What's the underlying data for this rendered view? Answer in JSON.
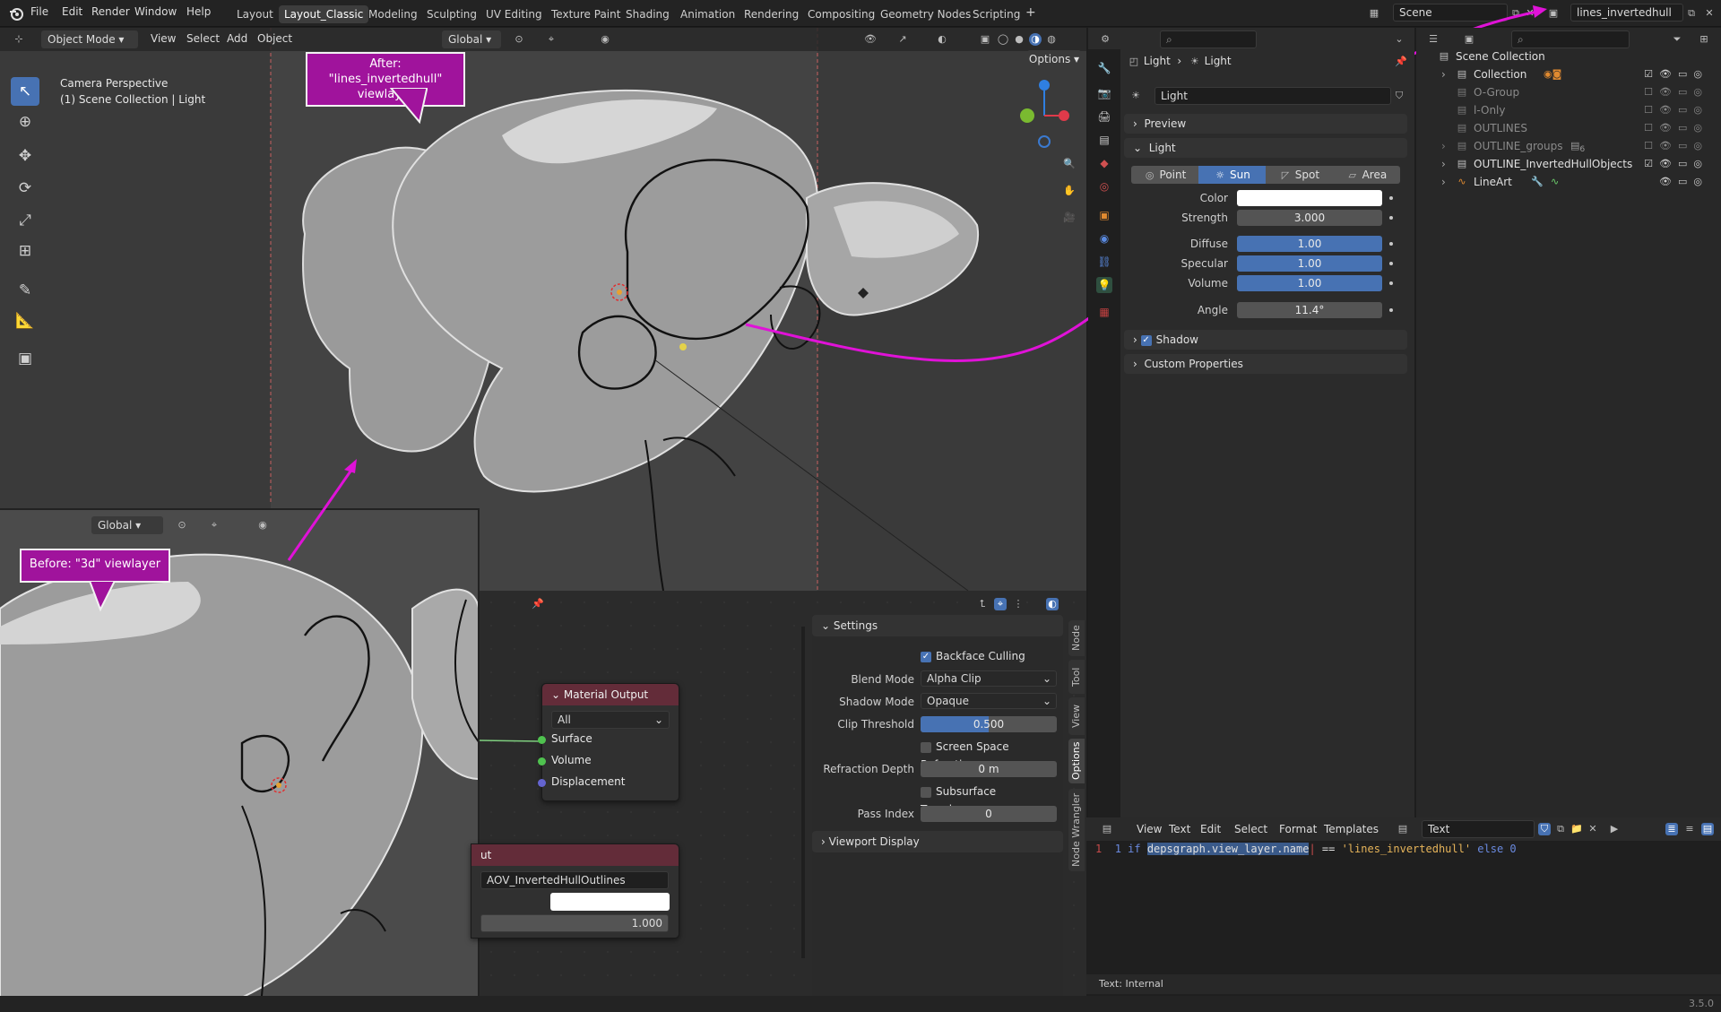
{
  "topbar": {
    "menus": [
      "File",
      "Edit",
      "Render",
      "Window",
      "Help"
    ],
    "workspaces": [
      "Layout",
      "Layout_Classic",
      "Modeling",
      "Sculpting",
      "UV Editing",
      "Texture Paint",
      "Shading",
      "Animation",
      "Rendering",
      "Compositing",
      "Geometry Nodes",
      "Scripting"
    ],
    "active_workspace": "Layout_Classic",
    "scene_name": "Scene",
    "view_layer_name": "lines_invertedhull"
  },
  "viewport": {
    "mode": "Object Mode",
    "menus": [
      "View",
      "Select",
      "Add",
      "Object"
    ],
    "orientation": "Global",
    "options_label": "Options",
    "info_line1": "Camera Perspective",
    "info_line2": "(1) Scene Collection | Light",
    "lower_orientation": "Global"
  },
  "callouts": {
    "after": "After: \"lines_invertedhull\" viewlayer",
    "before": "Before: \"3d\" viewlayer"
  },
  "node_editor": {
    "material_output": {
      "title": "Material Output",
      "target": "All",
      "sockets": [
        "Surface",
        "Volume",
        "Displacement"
      ]
    },
    "aov_node": {
      "title_fragment": "ut",
      "name": "AOV_InvertedHullOutlines",
      "value": "1.000"
    }
  },
  "settings_panel": {
    "title": "Settings",
    "backface_culling": "Backface Culling",
    "blend_mode_label": "Blend Mode",
    "blend_mode": "Alpha Clip",
    "shadow_mode_label": "Shadow Mode",
    "shadow_mode": "Opaque",
    "clip_threshold_label": "Clip Threshold",
    "clip_threshold": "0.500",
    "ssr_label": "Screen Space Refraction",
    "refraction_depth_label": "Refraction Depth",
    "refraction_depth": "0 m",
    "sss_label": "Subsurface Translucency",
    "pass_index_label": "Pass Index",
    "pass_index": "0",
    "viewport_display": "Viewport Display",
    "tabs": [
      "Node",
      "Tool",
      "View",
      "Options",
      "Node Wrangler"
    ]
  },
  "properties": {
    "breadcrumb_object": "Light",
    "breadcrumb_data": "Light",
    "datablock": "Light",
    "preview": "Preview",
    "light_section": "Light",
    "light_types": [
      "Point",
      "Sun",
      "Spot",
      "Area"
    ],
    "active_type": "Sun",
    "color_label": "Color",
    "color_value": "#ffffff",
    "strength_label": "Strength",
    "strength": "3.000",
    "diffuse_label": "Diffuse",
    "diffuse": "1.00",
    "specular_label": "Specular",
    "specular": "1.00",
    "volume_label": "Volume",
    "volume": "1.00",
    "angle_label": "Angle",
    "angle": "11.4°",
    "shadow": "Shadow",
    "custom_properties": "Custom Properties"
  },
  "outliner": {
    "root": "Scene Collection",
    "items": [
      {
        "name": "Collection",
        "dim": false
      },
      {
        "name": "O-Group",
        "dim": true
      },
      {
        "name": "l-Only",
        "dim": true
      },
      {
        "name": "OUTLINES",
        "dim": true
      },
      {
        "name": "OUTLINE_groups",
        "dim": true
      },
      {
        "name": "OUTLINE_InvertedHullObjects",
        "dim": false
      },
      {
        "name": "LineArt",
        "dim": false
      }
    ],
    "group_count": "6"
  },
  "text_editor": {
    "menus": [
      "View",
      "Text",
      "Edit",
      "Select",
      "Format",
      "Templates"
    ],
    "datablock": "Text",
    "line_number": "1",
    "code_prefix": "1 if ",
    "code_selected": "depsgraph.view_layer.name",
    "code_op": " == ",
    "code_string": "'lines_invertedhull'",
    "code_suffix": " else 0",
    "footer": "Text: Internal"
  },
  "status": {
    "version": "3.5.0"
  },
  "colors": {
    "accent": "#4772b3",
    "callout": "#a0139c",
    "arrow": "#e012d8",
    "node_header": "#632c39"
  }
}
